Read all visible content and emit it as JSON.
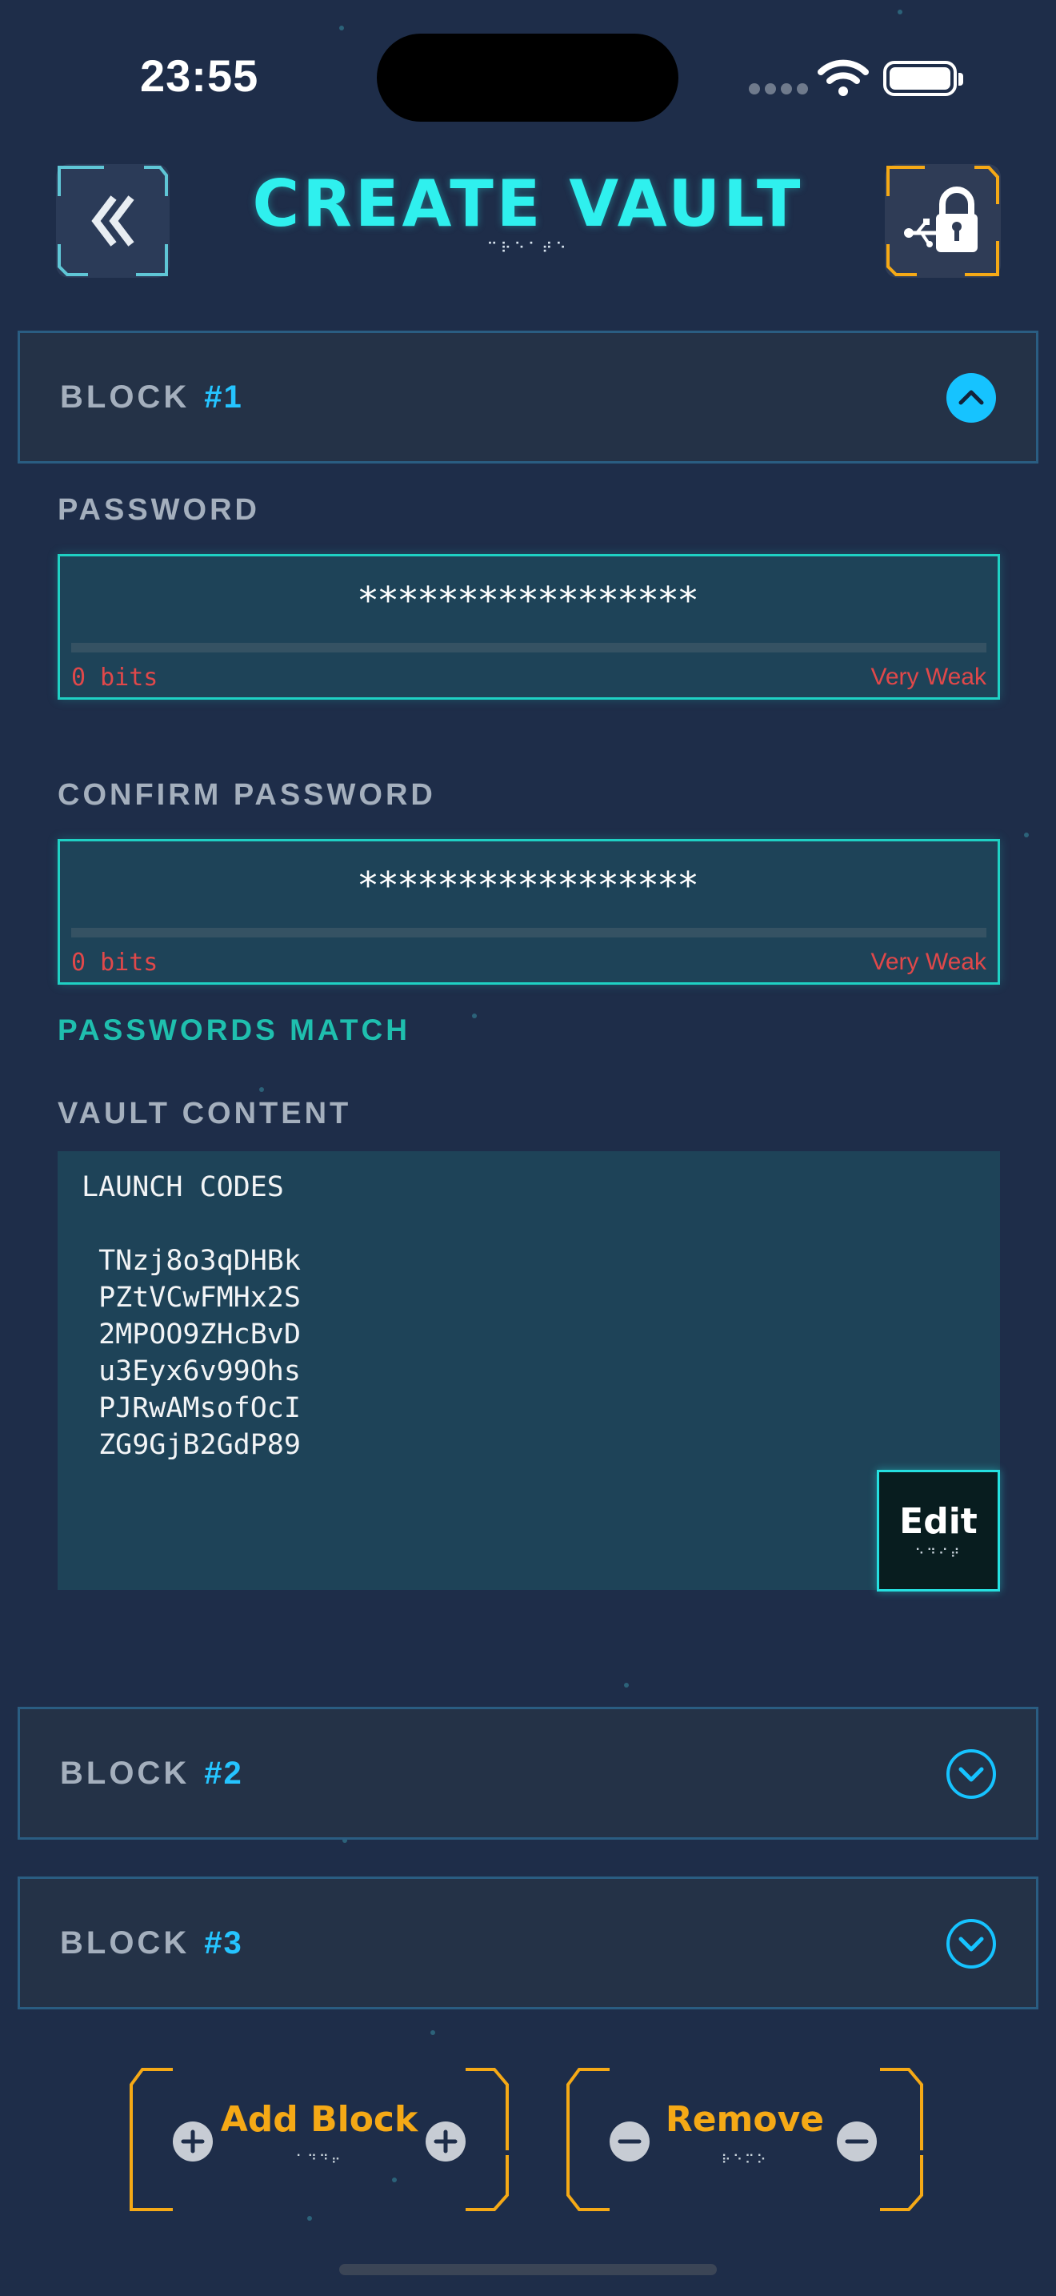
{
  "status_bar": {
    "time": "23:55"
  },
  "header": {
    "title": "CREATE VAULT",
    "title_sub": "⠉⠗⠑⠁⠞⠑",
    "back_icon": "double-chevron-left-icon",
    "lock_icon": "usb-lock-icon"
  },
  "blocks": [
    {
      "label": "BLOCK",
      "number": "#1",
      "expanded": true
    },
    {
      "label": "BLOCK",
      "number": "#2",
      "expanded": false
    },
    {
      "label": "BLOCK",
      "number": "#3",
      "expanded": false
    }
  ],
  "password": {
    "label": "PASSWORD",
    "value": "*****************",
    "bits": "0 bits",
    "strength": "Very Weak"
  },
  "confirm_password": {
    "label": "CONFIRM PASSWORD",
    "value": "*****************",
    "bits": "0 bits",
    "strength": "Very Weak"
  },
  "match_status": "PASSWORDS MATCH",
  "vault_content": {
    "label": "VAULT CONTENT",
    "text": "LAUNCH CODES\n\n TNzj8o3qDHBk\n PZtVCwFMHx2S\n 2MPOO9ZHcBvD\n u3Eyx6v99Ohs\n PJRwAMsofOcI\n ZG9GjB2GdP89"
  },
  "edit_button": {
    "label": "Edit",
    "sub": "⠑⠙⠊⠞"
  },
  "add_button": {
    "label": "Add Block",
    "sub": "⠁⠙⠙⠖"
  },
  "remove_button": {
    "label": "Remove",
    "sub": "⠗⠑⠍⠕"
  },
  "colors": {
    "background": "#1e2d49",
    "accent_cyan": "#2ff0ee",
    "accent_blue": "#16c3ff",
    "accent_orange": "#f5a916",
    "weak_red": "#e0484a",
    "match_green": "#1fbfae"
  }
}
